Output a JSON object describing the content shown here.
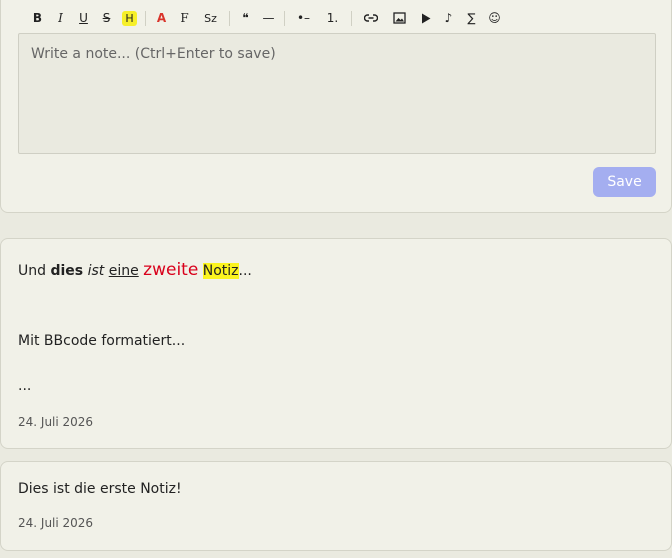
{
  "toolbar": {
    "bold": "B",
    "italic": "I",
    "underline": "U",
    "strike": "S",
    "highlight": "H",
    "color": "A",
    "font": "F",
    "size": "Sz",
    "quote": "❝",
    "hr": "—",
    "bullet_list": "•–",
    "ordered_list": "1.",
    "link": "🔗",
    "image": "🖼",
    "video": "▶",
    "audio": "♪",
    "formula": "∑",
    "emoji": "☺"
  },
  "editor": {
    "placeholder": "Write a note... (Ctrl+Enter to save)",
    "save_label": "Save"
  },
  "notes": [
    {
      "line1": {
        "und": "Und ",
        "dies": "dies",
        "space1": " ",
        "ist": "ist",
        "space2": " ",
        "eine": "eine",
        "space3": " ",
        "zweite": "zweite",
        "space4": " ",
        "notiz": "Notiz",
        "ellipsis": "..."
      },
      "line2": "Mit BBcode formatiert...",
      "line3": "...",
      "date": "24. Juli 2026"
    },
    {
      "text": "Dies ist die erste Notiz!",
      "date": "24. Juli 2026"
    }
  ]
}
